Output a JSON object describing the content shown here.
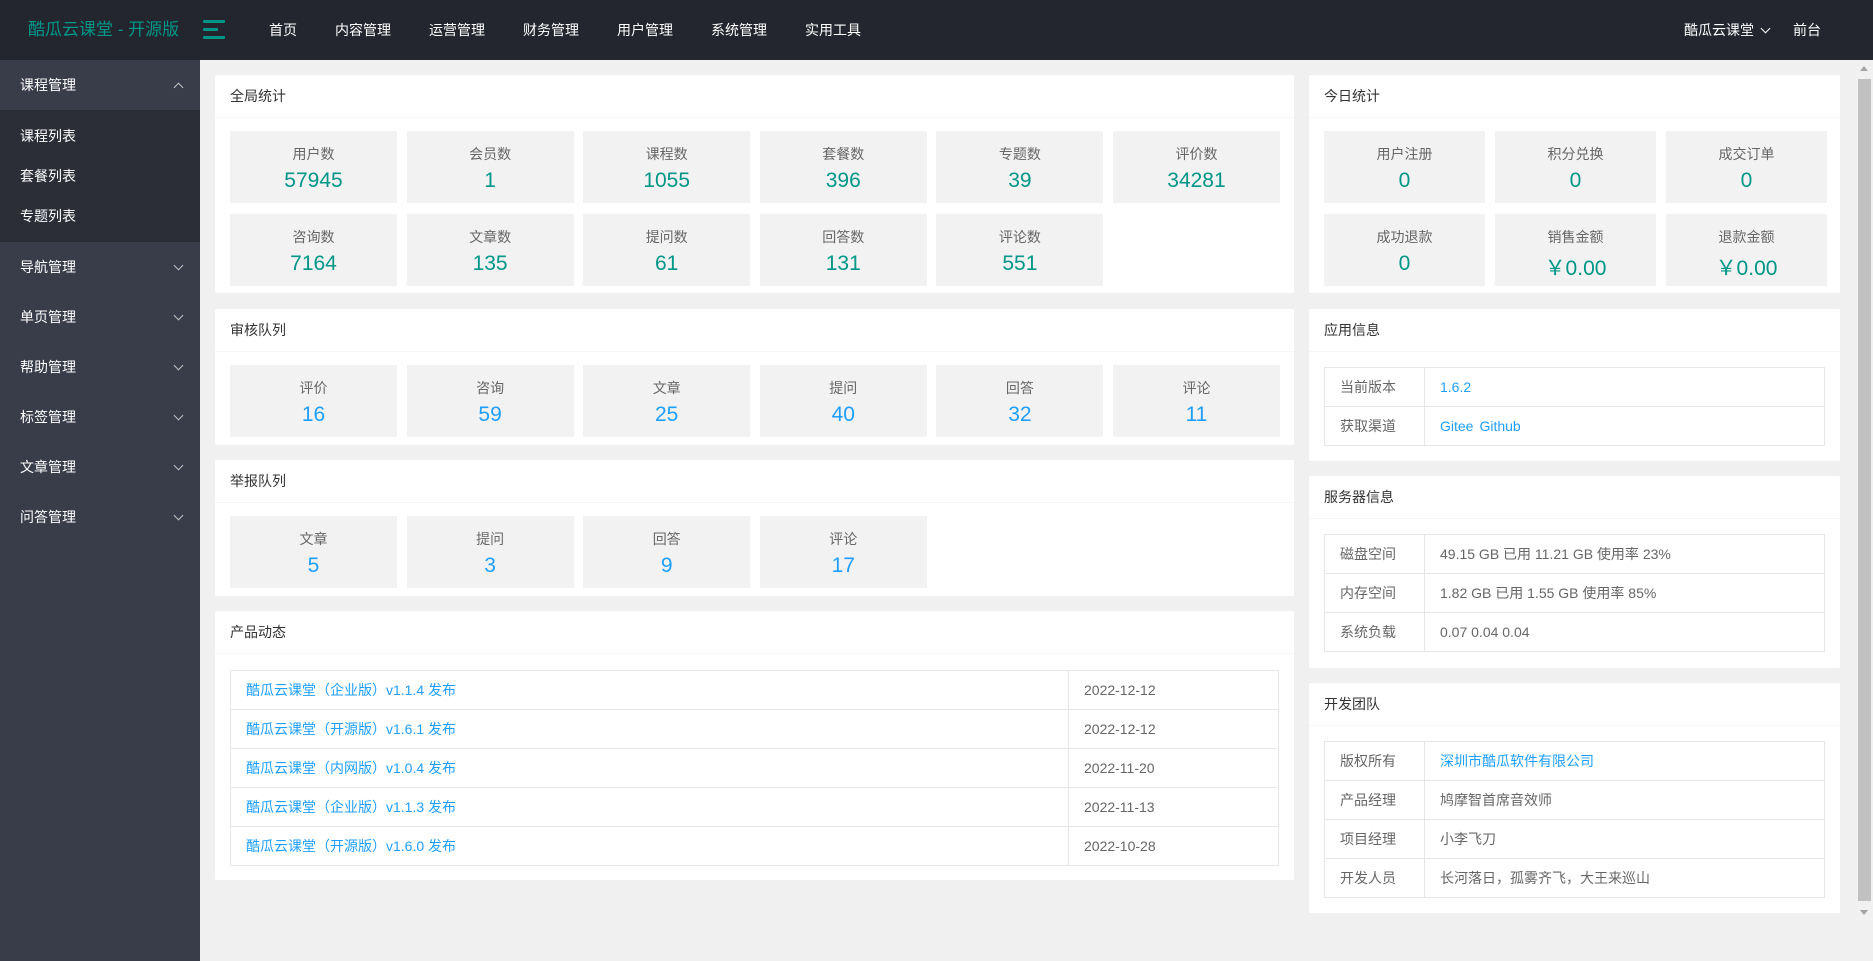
{
  "brand": "酷瓜云课堂 - 开源版",
  "top_nav": [
    "首页",
    "内容管理",
    "运营管理",
    "财务管理",
    "用户管理",
    "系统管理",
    "实用工具"
  ],
  "top_right": {
    "user": "酷瓜云课堂",
    "front": "前台"
  },
  "sidebar": {
    "open_group": "课程管理",
    "open_items": [
      "课程列表",
      "套餐列表",
      "专题列表"
    ],
    "groups": [
      "导航管理",
      "单页管理",
      "帮助管理",
      "标签管理",
      "文章管理",
      "问答管理"
    ]
  },
  "global_stats": {
    "title": "全局统计",
    "items": [
      {
        "label": "用户数",
        "value": "57945"
      },
      {
        "label": "会员数",
        "value": "1"
      },
      {
        "label": "课程数",
        "value": "1055"
      },
      {
        "label": "套餐数",
        "value": "396"
      },
      {
        "label": "专题数",
        "value": "39"
      },
      {
        "label": "评价数",
        "value": "34281"
      },
      {
        "label": "咨询数",
        "value": "7164"
      },
      {
        "label": "文章数",
        "value": "135"
      },
      {
        "label": "提问数",
        "value": "61"
      },
      {
        "label": "回答数",
        "value": "131"
      },
      {
        "label": "评论数",
        "value": "551"
      }
    ]
  },
  "audit_queue": {
    "title": "审核队列",
    "items": [
      {
        "label": "评价",
        "value": "16"
      },
      {
        "label": "咨询",
        "value": "59"
      },
      {
        "label": "文章",
        "value": "25"
      },
      {
        "label": "提问",
        "value": "40"
      },
      {
        "label": "回答",
        "value": "32"
      },
      {
        "label": "评论",
        "value": "11"
      }
    ]
  },
  "report_queue": {
    "title": "举报队列",
    "items": [
      {
        "label": "文章",
        "value": "5"
      },
      {
        "label": "提问",
        "value": "3"
      },
      {
        "label": "回答",
        "value": "9"
      },
      {
        "label": "评论",
        "value": "17"
      }
    ]
  },
  "product_news": {
    "title": "产品动态",
    "items": [
      {
        "title": "酷瓜云课堂（企业版）v1.1.4 发布",
        "date": "2022-12-12"
      },
      {
        "title": "酷瓜云课堂（开源版）v1.6.1 发布",
        "date": "2022-12-12"
      },
      {
        "title": "酷瓜云课堂（内网版）v1.0.4 发布",
        "date": "2022-11-20"
      },
      {
        "title": "酷瓜云课堂（企业版）v1.1.3 发布",
        "date": "2022-11-13"
      },
      {
        "title": "酷瓜云课堂（开源版）v1.6.0 发布",
        "date": "2022-10-28"
      }
    ]
  },
  "today_stats": {
    "title": "今日统计",
    "items": [
      {
        "label": "用户注册",
        "value": "0"
      },
      {
        "label": "积分兑换",
        "value": "0"
      },
      {
        "label": "成交订单",
        "value": "0"
      },
      {
        "label": "成功退款",
        "value": "0"
      },
      {
        "label": "销售金额",
        "value": "￥0.00"
      },
      {
        "label": "退款金额",
        "value": "￥0.00"
      }
    ]
  },
  "app_info": {
    "title": "应用信息",
    "version_label": "当前版本",
    "version": "1.6.2",
    "channel_label": "获取渠道",
    "channel_gitee": "Gitee",
    "channel_github": "Github"
  },
  "server_info": {
    "title": "服务器信息",
    "rows": [
      {
        "label": "磁盘空间",
        "value": "49.15 GB 已用 11.21 GB 使用率 23%"
      },
      {
        "label": "内存空间",
        "value": "1.82 GB 已用 1.55 GB 使用率 85%"
      },
      {
        "label": "系统负载",
        "value": "0.07 0.04 0.04"
      }
    ]
  },
  "dev_team": {
    "title": "开发团队",
    "copyright_label": "版权所有",
    "copyright": "深圳市酷瓜软件有限公司",
    "rows": [
      {
        "label": "产品经理",
        "value": "鸠摩智首席音效师"
      },
      {
        "label": "项目经理",
        "value": "小李飞刀"
      },
      {
        "label": "开发人员",
        "value": "长河落日，孤雾齐飞，大王来巡山"
      }
    ]
  },
  "colors": {
    "topbar": "#23262e",
    "sidebar": "#393d49",
    "accent_green": "#009688",
    "accent_blue": "#1e9fff"
  }
}
